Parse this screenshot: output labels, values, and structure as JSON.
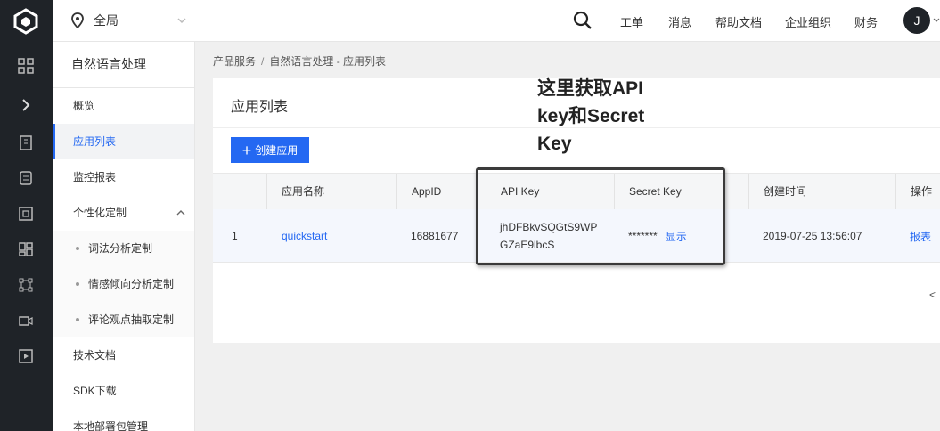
{
  "topbar": {
    "region": "全局",
    "nav": [
      "工单",
      "消息",
      "帮助文档",
      "企业组织",
      "财务"
    ],
    "avatar_initial": "J"
  },
  "sidemenu": {
    "title": "自然语言处理",
    "items": {
      "overview": "概览",
      "app_list": "应用列表",
      "monitor": "监控报表",
      "custom": "个性化定制",
      "lexical": "词法分析定制",
      "sentiment": "情感倾向分析定制",
      "comment": "评论观点抽取定制",
      "docs": "技术文档",
      "sdk": "SDK下载",
      "local": "本地部署包管理"
    }
  },
  "breadcrumb": {
    "root": "产品服务",
    "sep": "/",
    "current": "自然语言处理 - 应用列表"
  },
  "card": {
    "title": "应用列表",
    "create_label": "创建应用"
  },
  "table": {
    "headers": {
      "app_name": "应用名称",
      "app_id": "AppID",
      "api_key": "API Key",
      "secret_key": "Secret Key",
      "created": "创建时间",
      "ops": "操作"
    },
    "row": {
      "index": "1",
      "app_name": "quickstart",
      "app_id": "16881677",
      "api_key_line1": "jhDFBkvSQGtS9WP",
      "api_key_line2": "GZaE9lbcS",
      "secret_mask": "*******",
      "show_label": "显示",
      "created": "2019-07-25 13:56:07",
      "report": "报表"
    },
    "pager_prev": "<"
  },
  "annotation": {
    "text": "这里获取API\nkey和Secret\nKey"
  },
  "colors": {
    "accent": "#2468f2",
    "rail": "#1f2328"
  }
}
